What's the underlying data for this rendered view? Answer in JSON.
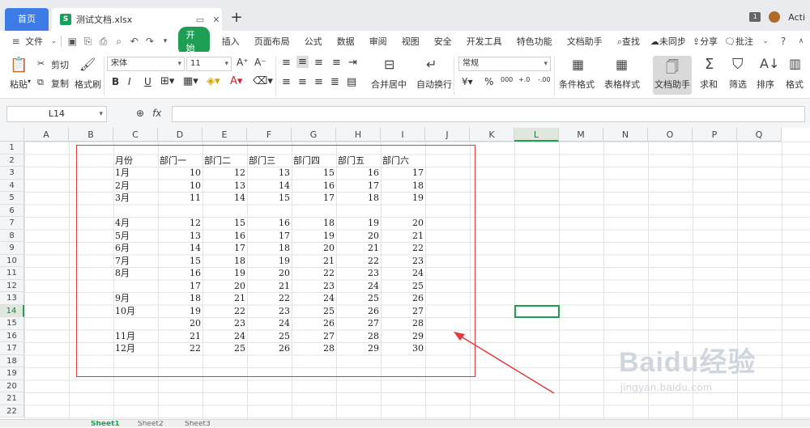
{
  "titlebar": {
    "home_tab": "首页",
    "doc_tab": "测试文档.xlsx",
    "file_icon_letter": "S",
    "badge": "1",
    "account": "Acti"
  },
  "menu": {
    "file": "文件",
    "start": "开始",
    "tabs": [
      "插入",
      "页面布局",
      "公式",
      "数据",
      "审阅",
      "视图",
      "安全",
      "开发工具",
      "特色功能",
      "文档助手"
    ],
    "search": "查找",
    "sync": "未同步",
    "share": "分享",
    "comment": "批注"
  },
  "ribbon": {
    "paste": "粘贴",
    "cut": "剪切",
    "copy": "复制",
    "format_painter": "格式刷",
    "font_name": "宋体",
    "font_size": "11",
    "merge_center": "合并居中",
    "wrap_text": "自动换行",
    "number_format": "常规",
    "conditional_format": "条件格式",
    "table_style": "表格样式",
    "doc_helper": "文档助手",
    "sum": "求和",
    "filter": "筛选",
    "sort": "排序",
    "format": "格式"
  },
  "formula_bar": {
    "name_box": "L14",
    "fx": "fx",
    "value": ""
  },
  "grid": {
    "columns": [
      "A",
      "B",
      "C",
      "D",
      "E",
      "F",
      "G",
      "H",
      "I",
      "J",
      "K",
      "L",
      "M",
      "N",
      "O",
      "P",
      "Q"
    ],
    "rows": [
      "1",
      "2",
      "3",
      "4",
      "5",
      "6",
      "7",
      "8",
      "9",
      "10",
      "11",
      "12",
      "13",
      "14",
      "15",
      "16",
      "17",
      "18",
      "19",
      "20",
      "21",
      "22"
    ],
    "selected_cell": "L14",
    "header_row": [
      "月份",
      "部门一",
      "部门二",
      "部门三",
      "部门四",
      "部门五",
      "部门六"
    ],
    "data": [
      {
        "row": 3,
        "label": "1月",
        "values": [
          "10",
          "12",
          "13",
          "15",
          "16",
          "17"
        ]
      },
      {
        "row": 4,
        "label": "2月",
        "values": [
          "10",
          "13",
          "14",
          "16",
          "17",
          "18"
        ]
      },
      {
        "row": 5,
        "label": "3月",
        "values": [
          "11",
          "14",
          "15",
          "17",
          "18",
          "19"
        ]
      },
      {
        "row": 7,
        "label": "4月",
        "values": [
          "12",
          "15",
          "16",
          "18",
          "19",
          "20"
        ]
      },
      {
        "row": 8,
        "label": "5月",
        "values": [
          "13",
          "16",
          "17",
          "19",
          "20",
          "21"
        ]
      },
      {
        "row": 9,
        "label": "6月",
        "values": [
          "14",
          "17",
          "18",
          "20",
          "21",
          "22"
        ]
      },
      {
        "row": 10,
        "label": "7月",
        "values": [
          "15",
          "18",
          "19",
          "21",
          "22",
          "23"
        ]
      },
      {
        "row": 11,
        "label": "8月",
        "values": [
          "16",
          "19",
          "20",
          "22",
          "23",
          "24"
        ]
      },
      {
        "row": 12,
        "label": "",
        "values": [
          "17",
          "20",
          "21",
          "23",
          "24",
          "25"
        ]
      },
      {
        "row": 13,
        "label": "9月",
        "values": [
          "18",
          "21",
          "22",
          "24",
          "25",
          "26"
        ]
      },
      {
        "row": 14,
        "label": "10月",
        "values": [
          "19",
          "22",
          "23",
          "25",
          "26",
          "27"
        ]
      },
      {
        "row": 15,
        "label": "",
        "values": [
          "20",
          "23",
          "24",
          "26",
          "27",
          "28"
        ]
      },
      {
        "row": 16,
        "label": "11月",
        "values": [
          "21",
          "24",
          "25",
          "27",
          "28",
          "29"
        ]
      },
      {
        "row": 17,
        "label": "12月",
        "values": [
          "22",
          "25",
          "26",
          "28",
          "29",
          "30"
        ]
      }
    ]
  },
  "sheets": [
    "Sheet1",
    "Sheet2",
    "Sheet3"
  ],
  "annotation_color": "#e33b3b",
  "watermark": {
    "text": "Baidu经验",
    "sub": "jingyan.baidu.com"
  }
}
